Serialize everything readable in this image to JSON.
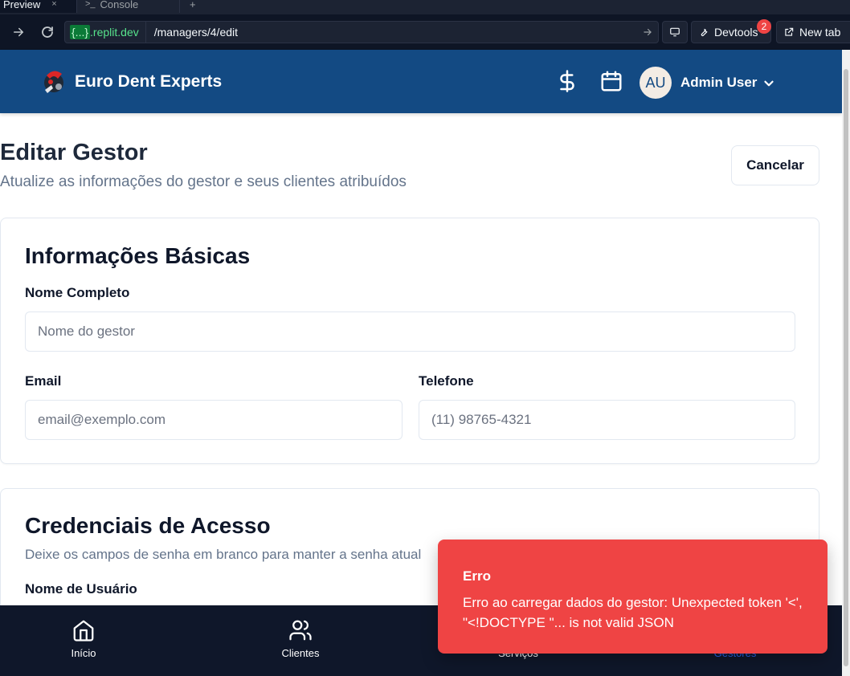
{
  "tabs": [
    {
      "label": "Preview",
      "close": "×"
    },
    {
      "label": "Console",
      "icon": "terminal-icon"
    }
  ],
  "urlbar": {
    "domain_prefix": "{...}",
    "domain_suffix": ".replit.dev",
    "path": "/managers/4/edit",
    "devtools_label": "Devtools",
    "devtools_badge": "2",
    "newtab_label": "New tab"
  },
  "header": {
    "brand": "Euro Dent Experts",
    "avatar_initials": "AU",
    "user_name": "Admin User",
    "color": "#134a83"
  },
  "page": {
    "title": "Editar Gestor",
    "subtitle": "Atualize as informações do gestor e seus clientes atribuídos",
    "cancel_label": "Cancelar"
  },
  "basic_info": {
    "heading": "Informações Básicas",
    "name_label": "Nome Completo",
    "name_placeholder": "Nome do gestor",
    "email_label": "Email",
    "email_placeholder": "email@exemplo.com",
    "phone_label": "Telefone",
    "phone_placeholder": "(11) 98765-4321"
  },
  "credentials": {
    "heading": "Credenciais de Acesso",
    "description": "Deixe os campos de senha em branco para manter a senha atual",
    "username_label": "Nome de Usuário"
  },
  "bottom_nav": {
    "items": [
      {
        "label": "Início",
        "icon": "home-icon"
      },
      {
        "label": "Clientes",
        "icon": "users-icon"
      },
      {
        "label": "Serviços",
        "icon": "wrench-icon"
      },
      {
        "label": "Gestores",
        "icon": "briefcase-icon"
      }
    ],
    "active_color": "#2563eb"
  },
  "toast": {
    "title": "Erro",
    "message": "Erro ao carregar dados do gestor: Unexpected token '<', \"<!DOCTYPE \"... is not valid JSON",
    "color": "#ef4444"
  }
}
